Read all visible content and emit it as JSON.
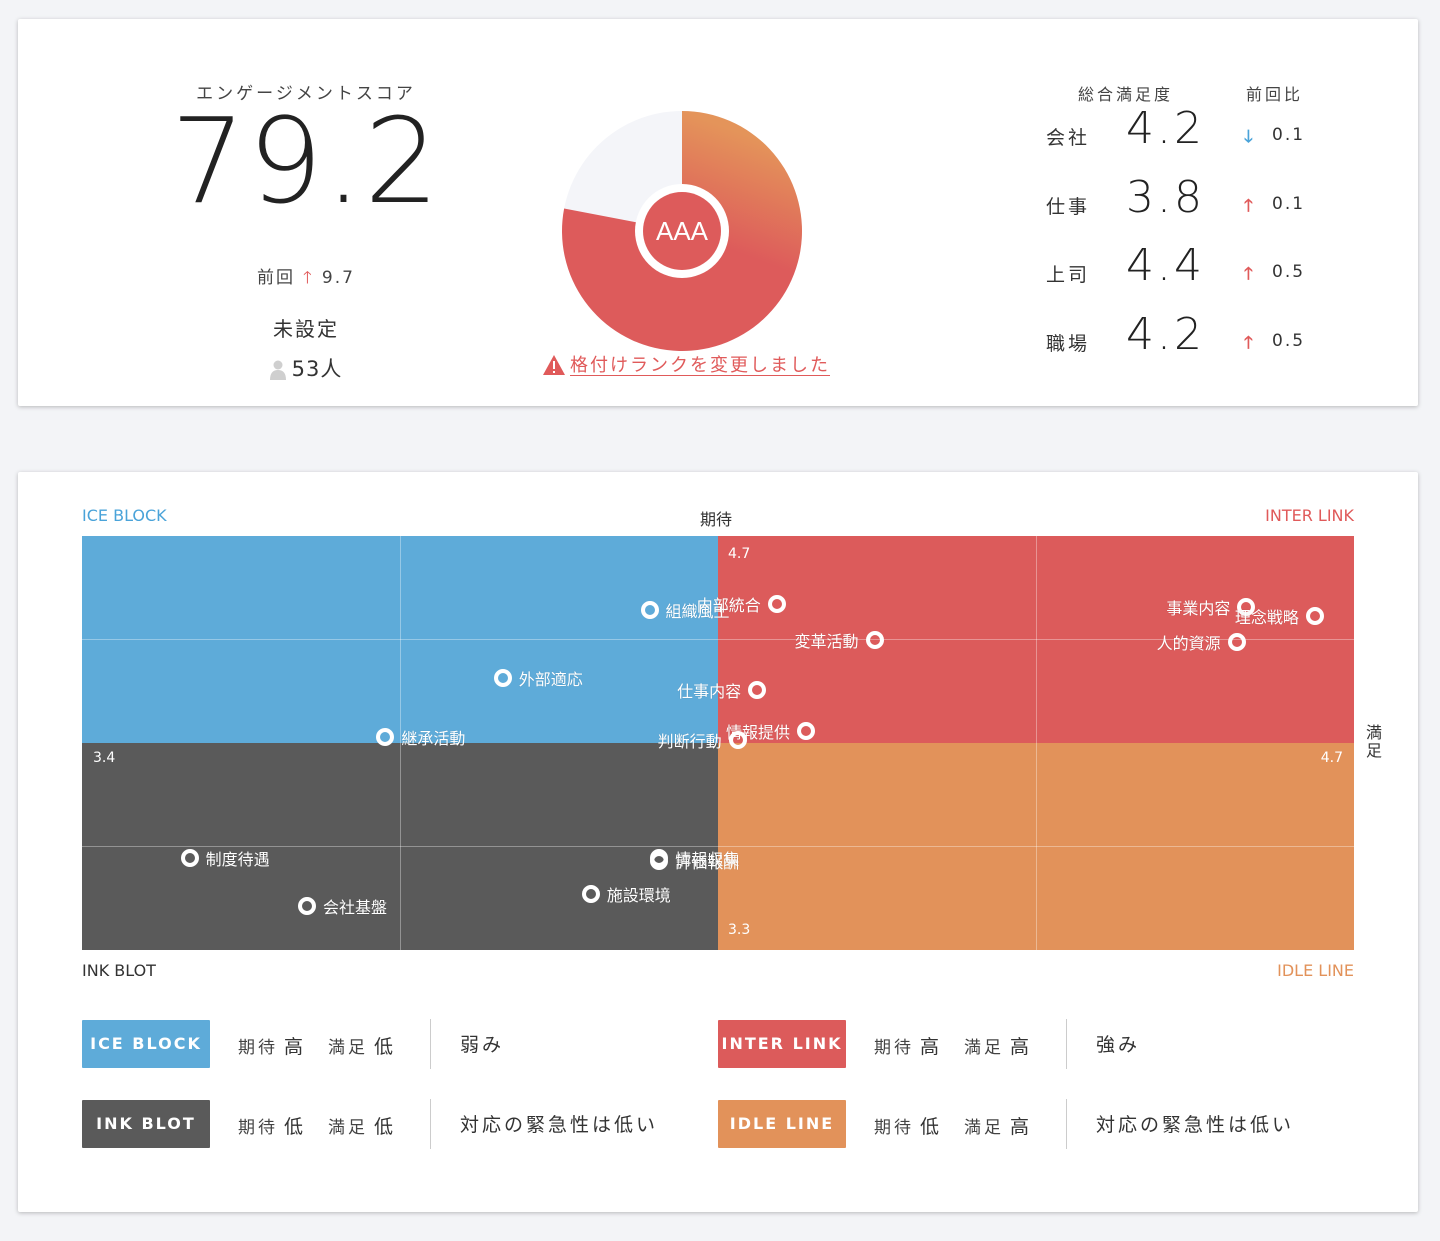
{
  "engagement": {
    "label": "エンゲージメントスコア",
    "score": "79.2",
    "prev_label": "前回",
    "prev_value": "9.7",
    "status": "未設定",
    "people": "53人"
  },
  "rank": {
    "badge": "AAA",
    "filled_fraction": 0.78,
    "warning": "格付けランクを変更しました",
    "colors": {
      "fill": "#dd5b5b",
      "gradient_top": "#e4945a",
      "empty": "#f4f5f9"
    }
  },
  "satisfaction": {
    "header_total": "総合満足度",
    "header_diff": "前回比",
    "rows": [
      {
        "label": "会社",
        "value": "4.2",
        "direction": "down",
        "diff": "0.1"
      },
      {
        "label": "仕事",
        "value": "3.8",
        "direction": "up",
        "diff": "0.1"
      },
      {
        "label": "上司",
        "value": "4.4",
        "direction": "up",
        "diff": "0.5"
      },
      {
        "label": "職場",
        "value": "4.2",
        "direction": "up",
        "diff": "0.5"
      }
    ]
  },
  "matrix": {
    "corner_top_left": "ICE BLOCK",
    "corner_top_right": "INTER LINK",
    "corner_bottom_left": "INK BLOT",
    "corner_bottom_right": "IDLE LINE",
    "y_axis_label": "期待",
    "x_axis_label": "満足",
    "ticks": {
      "y_max": "4.7",
      "y_min": "3.3",
      "x_min": "3.4",
      "x_max": "4.7"
    },
    "colors": {
      "ice": "#5eabd9",
      "inter": "#dc5b5b",
      "ink": "#5a5a5a",
      "idle": "#e2925a"
    }
  },
  "chart_data": {
    "type": "scatter",
    "x_label": "満足",
    "y_label": "期待",
    "xlim": [
      3.4,
      4.7
    ],
    "ylim": [
      3.3,
      4.7
    ],
    "points": [
      {
        "label": "組織風土",
        "x": 3.98,
        "y": 4.45,
        "label_side": "right"
      },
      {
        "label": "内部統合",
        "x": 4.11,
        "y": 4.47,
        "label_side": "left"
      },
      {
        "label": "変革活動",
        "x": 4.21,
        "y": 4.35,
        "label_side": "left"
      },
      {
        "label": "事業内容",
        "x": 4.59,
        "y": 4.46,
        "label_side": "left"
      },
      {
        "label": "理念戦略",
        "x": 4.66,
        "y": 4.43,
        "label_side": "left"
      },
      {
        "label": "人的資源",
        "x": 4.58,
        "y": 4.34,
        "label_side": "left"
      },
      {
        "label": "外部適応",
        "x": 3.83,
        "y": 4.22,
        "label_side": "right"
      },
      {
        "label": "仕事内容",
        "x": 4.09,
        "y": 4.18,
        "label_side": "left"
      },
      {
        "label": "情報提供",
        "x": 4.14,
        "y": 4.04,
        "label_side": "left"
      },
      {
        "label": "継承活動",
        "x": 3.71,
        "y": 4.02,
        "label_side": "right"
      },
      {
        "label": "判断行動",
        "x": 4.07,
        "y": 4.01,
        "label_side": "left"
      },
      {
        "label": "制度待遇",
        "x": 3.51,
        "y": 3.61,
        "label_side": "right"
      },
      {
        "label": "情報収集",
        "x": 3.99,
        "y": 3.61,
        "label_side": "right"
      },
      {
        "label": "評価報酬",
        "x": 3.99,
        "y": 3.6,
        "label_side": "right"
      },
      {
        "label": "施設環境",
        "x": 3.92,
        "y": 3.49,
        "label_side": "right"
      },
      {
        "label": "会社基盤",
        "x": 3.63,
        "y": 3.45,
        "label_side": "right"
      }
    ]
  },
  "legend": [
    {
      "badge": "ICE BLOCK",
      "color": "#5eabd9",
      "exp_label": "期待",
      "exp_value": "高",
      "sat_label": "満足",
      "sat_value": "低",
      "desc": "弱み"
    },
    {
      "badge": "INTER LINK",
      "color": "#dc5b5b",
      "exp_label": "期待",
      "exp_value": "高",
      "sat_label": "満足",
      "sat_value": "高",
      "desc": "強み"
    },
    {
      "badge": "INK BLOT",
      "color": "#5a5a5a",
      "exp_label": "期待",
      "exp_value": "低",
      "sat_label": "満足",
      "sat_value": "低",
      "desc": "対応の緊急性は低い"
    },
    {
      "badge": "IDLE LINE",
      "color": "#e2925a",
      "exp_label": "期待",
      "exp_value": "低",
      "sat_label": "満足",
      "sat_value": "高",
      "desc": "対応の緊急性は低い"
    }
  ]
}
